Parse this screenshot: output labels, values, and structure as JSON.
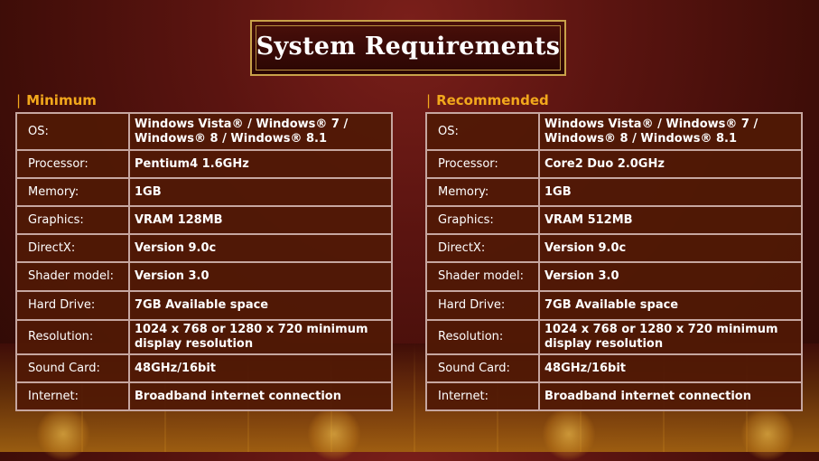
{
  "title": "System Requirements",
  "sections": [
    {
      "heading": "Minimum",
      "rows": [
        {
          "label": "OS:",
          "value": "Windows Vista® / Windows® 7 / Windows® 8 / Windows® 8.1"
        },
        {
          "label": "Processor:",
          "value": "Pentium4 1.6GHz"
        },
        {
          "label": "Memory:",
          "value": "1GB"
        },
        {
          "label": "Graphics:",
          "value": "VRAM 128MB"
        },
        {
          "label": "DirectX:",
          "value": "Version 9.0c"
        },
        {
          "label": "Shader model:",
          "value": "Version 3.0"
        },
        {
          "label": "Hard Drive:",
          "value": "7GB Available space"
        },
        {
          "label": "Resolution:",
          "value": "1024 x 768 or 1280 x 720 minimum display resolution"
        },
        {
          "label": "Sound Card:",
          "value": "48GHz/16bit"
        },
        {
          "label": "Internet:",
          "value": "Broadband internet connection"
        }
      ]
    },
    {
      "heading": "Recommended",
      "rows": [
        {
          "label": "OS:",
          "value": "Windows Vista® / Windows® 7 / Windows® 8 / Windows® 8.1"
        },
        {
          "label": "Processor:",
          "value": "Core2 Duo 2.0GHz"
        },
        {
          "label": "Memory:",
          "value": "1GB"
        },
        {
          "label": "Graphics:",
          "value": "VRAM 512MB"
        },
        {
          "label": "DirectX:",
          "value": "Version 9.0c"
        },
        {
          "label": "Shader model:",
          "value": "Version 3.0"
        },
        {
          "label": "Hard Drive:",
          "value": "7GB Available space"
        },
        {
          "label": "Resolution:",
          "value": "1024 x 768 or 1280 x 720 minimum display resolution"
        },
        {
          "label": "Sound Card:",
          "value": "48GHz/16bit"
        },
        {
          "label": "Internet:",
          "value": "Broadband internet connection"
        }
      ]
    }
  ],
  "colors": {
    "accent": "#f2a81c",
    "frame": "#c9a24a",
    "cell_border": "#c6a6a0",
    "background": "#5a1410"
  }
}
